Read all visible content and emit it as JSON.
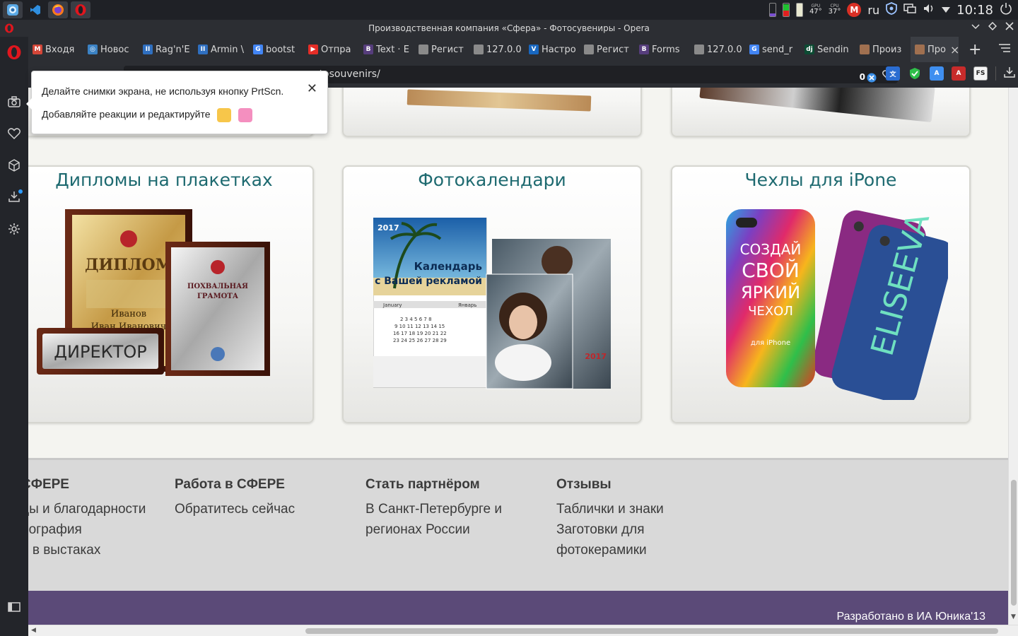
{
  "taskbar": {
    "apps": [
      "finder-app-icon",
      "vscode-app-icon",
      "firefox-app-icon",
      "opera-app-icon"
    ],
    "gpu_label": "GPU",
    "gpu_temp": "47°",
    "cpu_label": "CPU",
    "cpu_temp": "37°",
    "language": "ru",
    "clock": "10:18"
  },
  "window": {
    "title": "Производственная компания «Сфера» - Фотосувениры - Opera"
  },
  "tabs": [
    {
      "label": "Входя",
      "icon": "gmail-icon",
      "color": "#d44638",
      "glyph": "M"
    },
    {
      "label": "Новос",
      "icon": "news-icon",
      "color": "#3b82c4",
      "glyph": "◎"
    },
    {
      "label": "Rag'n'E",
      "icon": "trello-icon",
      "color": "#2f6fc0",
      "glyph": "II"
    },
    {
      "label": "Armin \\",
      "icon": "trello-icon",
      "color": "#2f6fc0",
      "glyph": "II"
    },
    {
      "label": "bootst",
      "icon": "google-icon",
      "color": "#4285f4",
      "glyph": "G"
    },
    {
      "label": "Отпра",
      "icon": "youtube-icon",
      "color": "#e52d27",
      "glyph": "▶"
    },
    {
      "label": "Text · E",
      "icon": "bootstrap-icon",
      "color": "#563d7c",
      "glyph": "B"
    },
    {
      "label": "Регист",
      "icon": "page-icon",
      "color": "#8a8a8a",
      "glyph": ""
    },
    {
      "label": "127.0.0",
      "icon": "page-icon",
      "color": "#8a8a8a",
      "glyph": ""
    },
    {
      "label": "Настро",
      "icon": "vuetify-icon",
      "color": "#1867c0",
      "glyph": "V"
    },
    {
      "label": "Регист",
      "icon": "page-icon",
      "color": "#8a8a8a",
      "glyph": ""
    },
    {
      "label": "Forms",
      "icon": "bootstrap-icon",
      "color": "#563d7c",
      "glyph": "B"
    },
    {
      "label": "127.0.0",
      "icon": "page-icon",
      "color": "#8a8a8a",
      "glyph": ""
    },
    {
      "label": "send_r",
      "icon": "google-icon",
      "color": "#4285f4",
      "glyph": "G"
    },
    {
      "label": "Sendin",
      "icon": "django-icon",
      "color": "#0c4b33",
      "glyph": "dj"
    },
    {
      "label": "Произ",
      "icon": "site-icon",
      "color": "#a07050",
      "glyph": ""
    },
    {
      "label": "Про",
      "icon": "site-icon",
      "color": "#a07050",
      "glyph": "",
      "active": true
    }
  ],
  "address": {
    "url_visible": "otosouvenirs/",
    "adblock_count": "0"
  },
  "popup": {
    "line1": "Делайте снимки экрана, не используя кнопку PrtScn.",
    "line2": "Добавляйте реакции и редактируйте"
  },
  "page": {
    "cards": [
      {
        "title": "Дипломы на плакетках",
        "image": "diploma-plaques-image",
        "plaque_word": "ДИРЕКТОР",
        "diploma_word": "ДИПЛОМ",
        "certificate_word": "ПОХВАЛЬНАЯ ГРАМОТА",
        "name_line1": "Иванов",
        "name_line2": "Иван Иванович"
      },
      {
        "title": "Фотокалендари",
        "image": "photo-calendars-image",
        "year": "2017",
        "cal_line1": "Календарь",
        "cal_line2": "с Вашей рекламой",
        "month_en": "January",
        "month_ru": "Январь"
      },
      {
        "title": "Чехлы для iPone",
        "image": "iphone-cases-image",
        "case_line1": "СОЗДАЙ",
        "case_line2": "СВОЙ",
        "case_line3": "ЯРКИЙ",
        "case_line4": "ЧЕХОЛ",
        "case_line5": "для iPhone",
        "case_name": "ELISEEVA"
      }
    ],
    "footer": {
      "columns": [
        {
          "heading": "СФЕРЕ",
          "links": [
            "ды и благодарности",
            "еография",
            "е в выстаках"
          ]
        },
        {
          "heading": "Работа в СФЕРЕ",
          "links": [
            "Обратитесь сейчас"
          ]
        },
        {
          "heading": "Стать партнёром",
          "links": [
            "В Санкт-Петербурге и",
            "регионах России"
          ]
        },
        {
          "heading": "Отзывы",
          "links": [
            "Таблички и знаки",
            "Заготовки для",
            "фотокерамики"
          ]
        }
      ],
      "credit": "Разработано в ИА Юника'13"
    }
  },
  "colors": {
    "card_title": "#1e6a70",
    "footer_bottom": "#5b4a78",
    "opera_red": "#e0161e"
  }
}
